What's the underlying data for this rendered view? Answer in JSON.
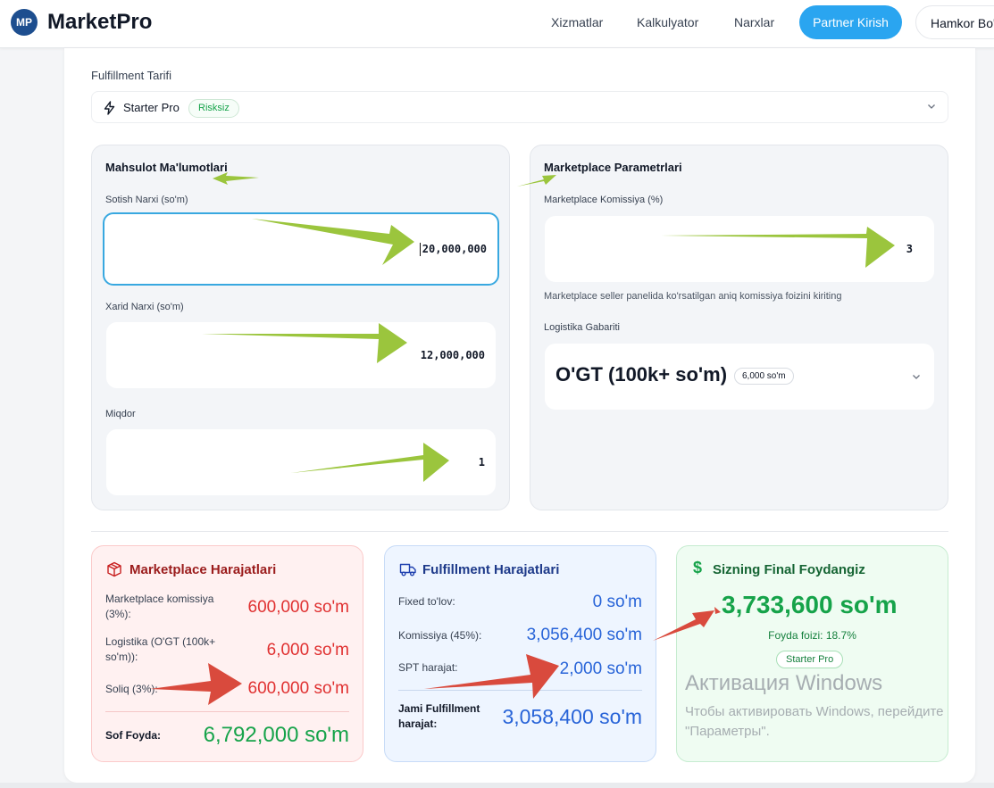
{
  "nav": {
    "logo_mark": "MP",
    "logo_text": "MarketPro",
    "links": [
      "Xizmatlar",
      "Kalkulyator",
      "Narxlar"
    ],
    "partner_button": "Partner Kirish",
    "hamkor_button": "Hamkor Bo'"
  },
  "tariff": {
    "label": "Fulfillment Tarifi",
    "selected": "Starter Pro",
    "badge": "Risksiz"
  },
  "product": {
    "title": "Mahsulot Ma'lumotlari",
    "sale_label": "Sotish Narxi (so'm)",
    "sale_value": "20,000,000",
    "purchase_label": "Xarid Narxi (so'm)",
    "purchase_value": "12,000,000",
    "qty_label": "Miqdor",
    "qty_value": "1"
  },
  "marketplace": {
    "title": "Marketplace Parametrlari",
    "commission_label": "Marketplace Komissiya (%)",
    "commission_value": "3",
    "commission_hint": "Marketplace seller panelida ko'rsatilgan aniq komissiya foizini kiriting",
    "logistics_label": "Logistika Gabariti",
    "logistics_value": "O'GT (100k+ so'm)",
    "logistics_badge": "6,000 so'm"
  },
  "mp_costs": {
    "title": "Marketplace Harajatlari",
    "commission_label": "Marketplace komissiya (3%):",
    "commission_value": "600,000 so'm",
    "logistics_label": "Logistika (O'GT (100k+ so'm)):",
    "logistics_value": "6,000 so'm",
    "tax_label": "Soliq (3%):",
    "tax_value": "600,000 so'm",
    "net_label": "Sof Foyda:",
    "net_value": "6,792,000 so'm"
  },
  "ff_costs": {
    "title": "Fulfillment Harajatlari",
    "fixed_label": "Fixed to'lov:",
    "fixed_value": "0 so'm",
    "commission_label": "Komissiya (45%):",
    "commission_value": "3,056,400 so'm",
    "spt_label": "SPT harajat:",
    "spt_value": "2,000 so'm",
    "total_label": "Jami Fulfillment harajat:",
    "total_value": "3,058,400 so'm"
  },
  "final": {
    "title": "Sizning Final Foydangiz",
    "amount": "3,733,600 so'm",
    "percent": "Foyda foizi: 18.7%",
    "badge": "Starter Pro"
  },
  "windows_watermark": {
    "title": "Активация Windows",
    "line1": "Чтобы активировать Windows, перейдите",
    "line2": "\"Параметры\"."
  },
  "colors": {
    "accent_blue": "#2aa5f0",
    "annotation_green": "#9bc53d",
    "annotation_red": "#d94a3d",
    "red_value": "#e03131",
    "blue_value": "#2864d8",
    "green_value": "#16a34a"
  }
}
